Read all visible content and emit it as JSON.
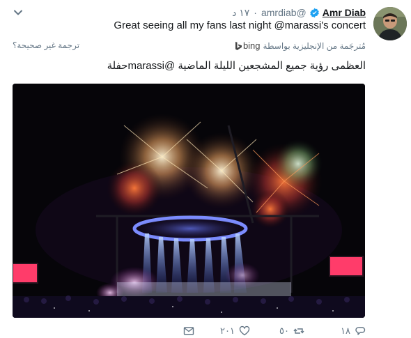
{
  "tweet": {
    "author_name": "Amr Diab",
    "handle": "@amrdiab",
    "separator": "·",
    "time": "١٧ د",
    "text": "Great seeing all my fans last night @marassi's concert",
    "translation": {
      "translated_from": "مُترجَمة من الإنجليزية بواسطة",
      "provider": "bing",
      "wrong_translation": "ترجمة غير صحيحة؟",
      "text": "العظمى رؤية جميع المشجعين الليلة الماضية @marassiحفلة"
    },
    "actions": {
      "replies": "١٨",
      "retweets": "٥٠",
      "likes": "٢٠١",
      "dm": ""
    }
  },
  "colors": {
    "text": "#14171a",
    "muted": "#657786",
    "verified": "#1da1f2"
  },
  "icons": {
    "caret": "chevron-down-icon",
    "verified": "verified-badge-icon",
    "bing": "bing-logo-icon",
    "reply": "reply-icon",
    "retweet": "retweet-icon",
    "like": "heart-icon",
    "dm": "direct-message-icon"
  }
}
